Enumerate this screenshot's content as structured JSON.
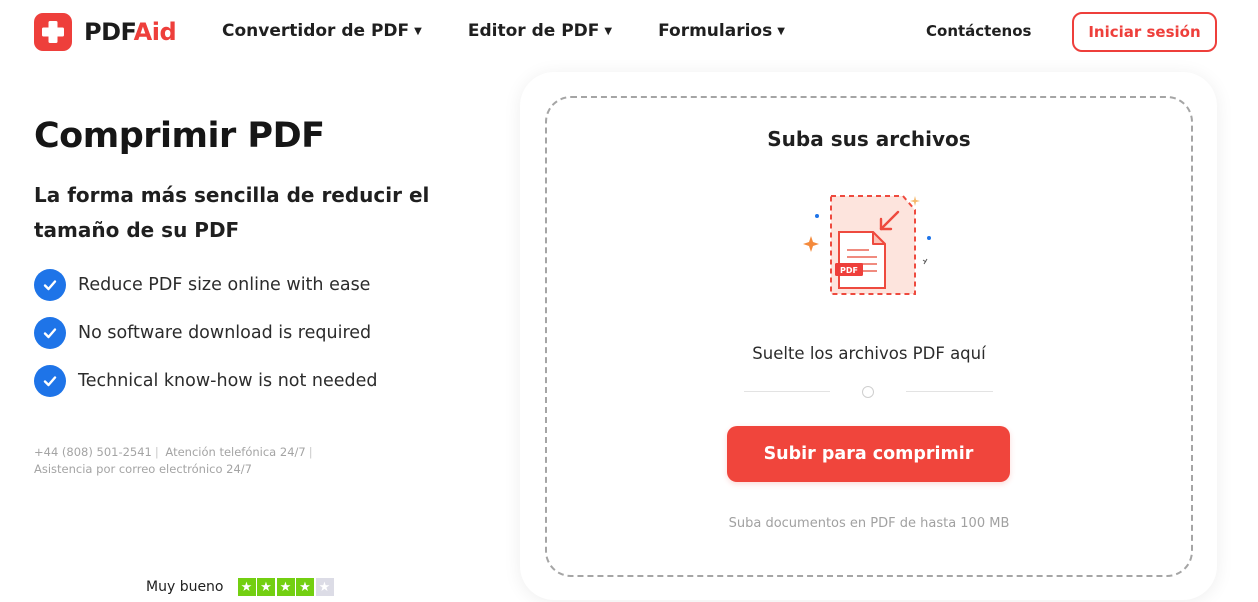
{
  "brand": {
    "name_part1": "PDF",
    "name_part2": "Aid",
    "accent": "#ee3f3b"
  },
  "nav": {
    "items": [
      {
        "label": "Convertidor de PDF"
      },
      {
        "label": "Editor de PDF"
      },
      {
        "label": "Formularios"
      }
    ],
    "contact_label": "Contáctenos",
    "login_label": "Iniciar sesión"
  },
  "hero": {
    "title": "Comprimir PDF",
    "subtitle": "La forma más sencilla de reducir el tamaño de su PDF",
    "features": [
      "Reduce PDF size online with ease",
      "No software download is required",
      "Technical know-how is not needed"
    ],
    "contact": {
      "phone": "+44 (808) 501-2541",
      "phone_support": "Atención telefónica 24/7",
      "email_support": "Asistencia por correo electrónico 24/7"
    },
    "rating": {
      "label": "Muy bueno",
      "stars_filled": 4,
      "stars_total": 5
    }
  },
  "upload": {
    "title": "Suba sus archivos",
    "illustration_label": "PDF",
    "drop_text": "Suelte los archivos PDF aquí",
    "button_label": "Subir para comprimir",
    "hint": "Suba documentos en PDF de hasta 100 MB"
  },
  "icons": {
    "logo": "plus-icon",
    "caret": "chevron-down-icon",
    "check": "check-icon",
    "illustration": "compress-pdf-illustration"
  },
  "colors": {
    "check_blue": "#1e74e8",
    "button_red": "#f0453c",
    "star_green": "#73cf11"
  }
}
